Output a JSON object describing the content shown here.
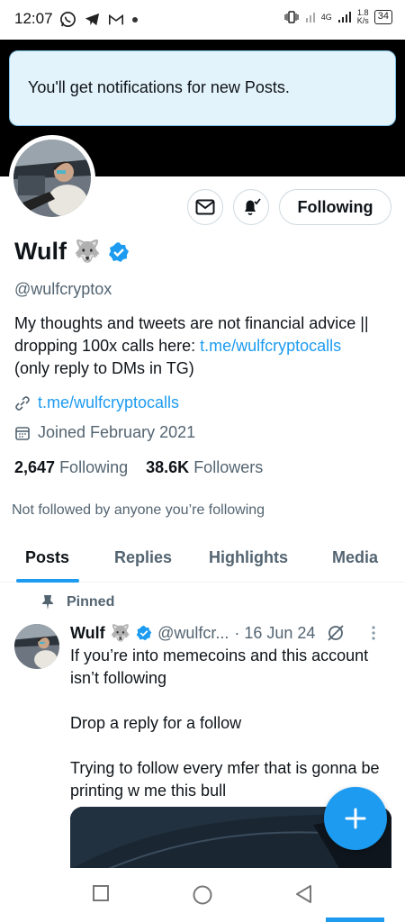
{
  "status_bar": {
    "time": "12:07",
    "left_icons": [
      "whatsapp-icon",
      "telegram-icon",
      "gmail-icon",
      "dot-icon"
    ],
    "network_type": "4G",
    "speed_value": "1.8",
    "speed_unit": "K/s",
    "battery": "34"
  },
  "toast": {
    "text": "You'll get notifications for new Posts.",
    "background": "#e3f3fb"
  },
  "profile": {
    "name": "Wulf",
    "name_emoji": "🐺",
    "verified_color": "#1d9bf0",
    "handle": "@wulfcryptox",
    "bio_text": "My thoughts and tweets are not financial advice || dropping 100x calls here: ",
    "bio_link": "t.me/wulfcryptocalls",
    "bio_suffix": "(only reply to DMs in TG)",
    "website": "t.me/wulfcryptocalls",
    "joined": "Joined February 2021",
    "following_count": "2,647",
    "following_label": "Following",
    "followers_count": "38.6K",
    "followers_label": "Followers",
    "not_followed": "Not followed by anyone you’re following"
  },
  "actions": {
    "message_icon": "mail-icon",
    "notify_icon": "bell-icon",
    "follow_label": "Following"
  },
  "tabs": [
    {
      "label": "Posts",
      "active": true
    },
    {
      "label": "Replies",
      "active": false
    },
    {
      "label": "Highlights",
      "active": false
    },
    {
      "label": "Media",
      "active": false
    }
  ],
  "tweet": {
    "pinned_label": "Pinned",
    "name": "Wulf",
    "emoji": "🐺",
    "handle": "@wulfcr...",
    "date": "· 16 Jun 24",
    "text": "If you’re into memecoins and this account isn’t following\n\nDrop a reply for a follow\n\nTrying to follow every mfer that is gonna be printing w me this bull"
  },
  "fab": {
    "icon": "plus-icon"
  },
  "colors": {
    "accent": "#1d9bf0",
    "secondary_text": "#536471"
  }
}
